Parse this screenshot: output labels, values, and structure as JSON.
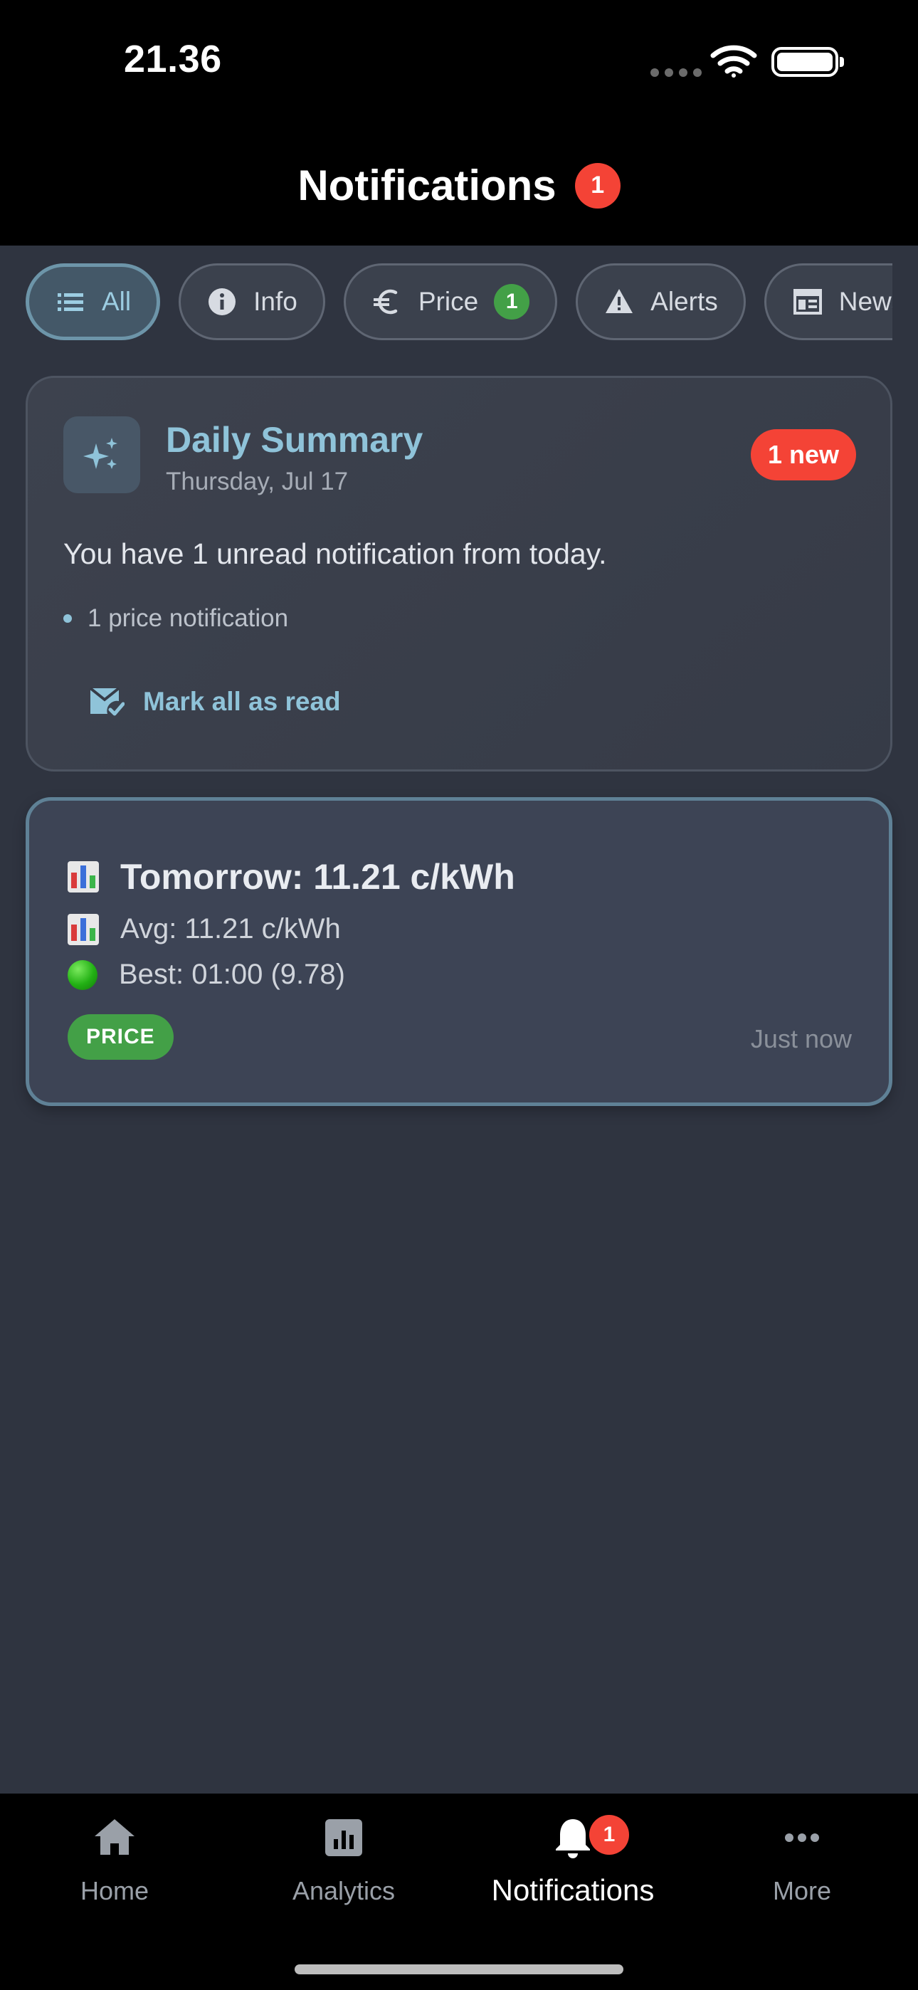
{
  "status_bar": {
    "time": "21.36"
  },
  "header": {
    "title": "Notifications",
    "badge": "1"
  },
  "filters": [
    {
      "label": "All",
      "icon": "list-icon",
      "active": true
    },
    {
      "label": "Info",
      "icon": "info-icon"
    },
    {
      "label": "Price",
      "icon": "euro-icon",
      "count": "1"
    },
    {
      "label": "Alerts",
      "icon": "warning-icon"
    },
    {
      "label": "News",
      "icon": "news-icon"
    }
  ],
  "summary": {
    "title": "Daily Summary",
    "date": "Thursday, Jul 17",
    "new_badge": "1 new",
    "text": "You have 1 unread notification from today.",
    "bullet": "1 price notification",
    "mark_all_label": "Mark all as read"
  },
  "notification": {
    "title": "Tomorrow: 11.21 c/kWh",
    "avg": "Avg: 11.21 c/kWh",
    "best": "Best: 01:00 (9.78)",
    "tag": "PRICE",
    "time": "Just now"
  },
  "nav": {
    "home": "Home",
    "analytics": "Analytics",
    "notifications": "Notifications",
    "notifications_badge": "1",
    "more": "More"
  },
  "colors": {
    "accent": "#8fc3d9",
    "badge_red": "#f44336",
    "price_green": "#43a047",
    "background": "#2f3440"
  }
}
